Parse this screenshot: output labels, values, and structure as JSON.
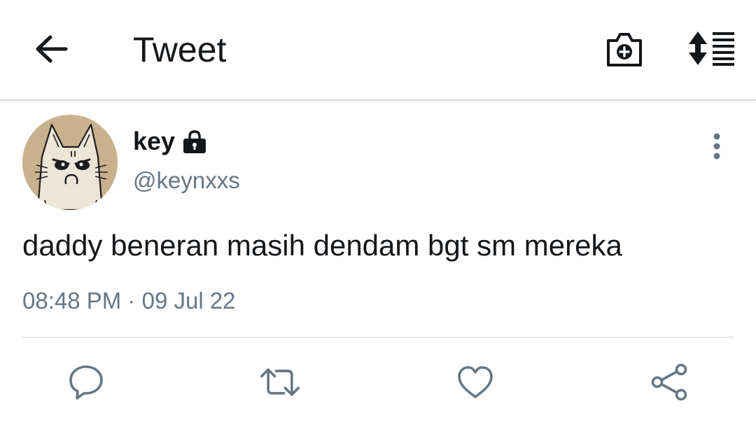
{
  "header": {
    "title": "Tweet",
    "back_icon": "arrow-left-icon",
    "camera_icon": "camera-add-icon",
    "sort_icon": "sort-list-icon"
  },
  "tweet": {
    "author_name": "key",
    "protected": true,
    "handle": "@keynxxs",
    "text": "daddy beneran masih dendam bgt sm mereka",
    "time": "08:48 PM",
    "separator": "·",
    "date": "09 Jul 22"
  },
  "actions": [
    {
      "name": "reply",
      "icon": "speech-bubble-icon"
    },
    {
      "name": "retweet",
      "icon": "retweet-icon"
    },
    {
      "name": "like",
      "icon": "heart-icon"
    },
    {
      "name": "share",
      "icon": "share-icon"
    }
  ],
  "colors": {
    "primary_text": "#14171a",
    "secondary_text": "#657786",
    "icon_gray": "#657786",
    "divider": "#e1e6ea"
  }
}
